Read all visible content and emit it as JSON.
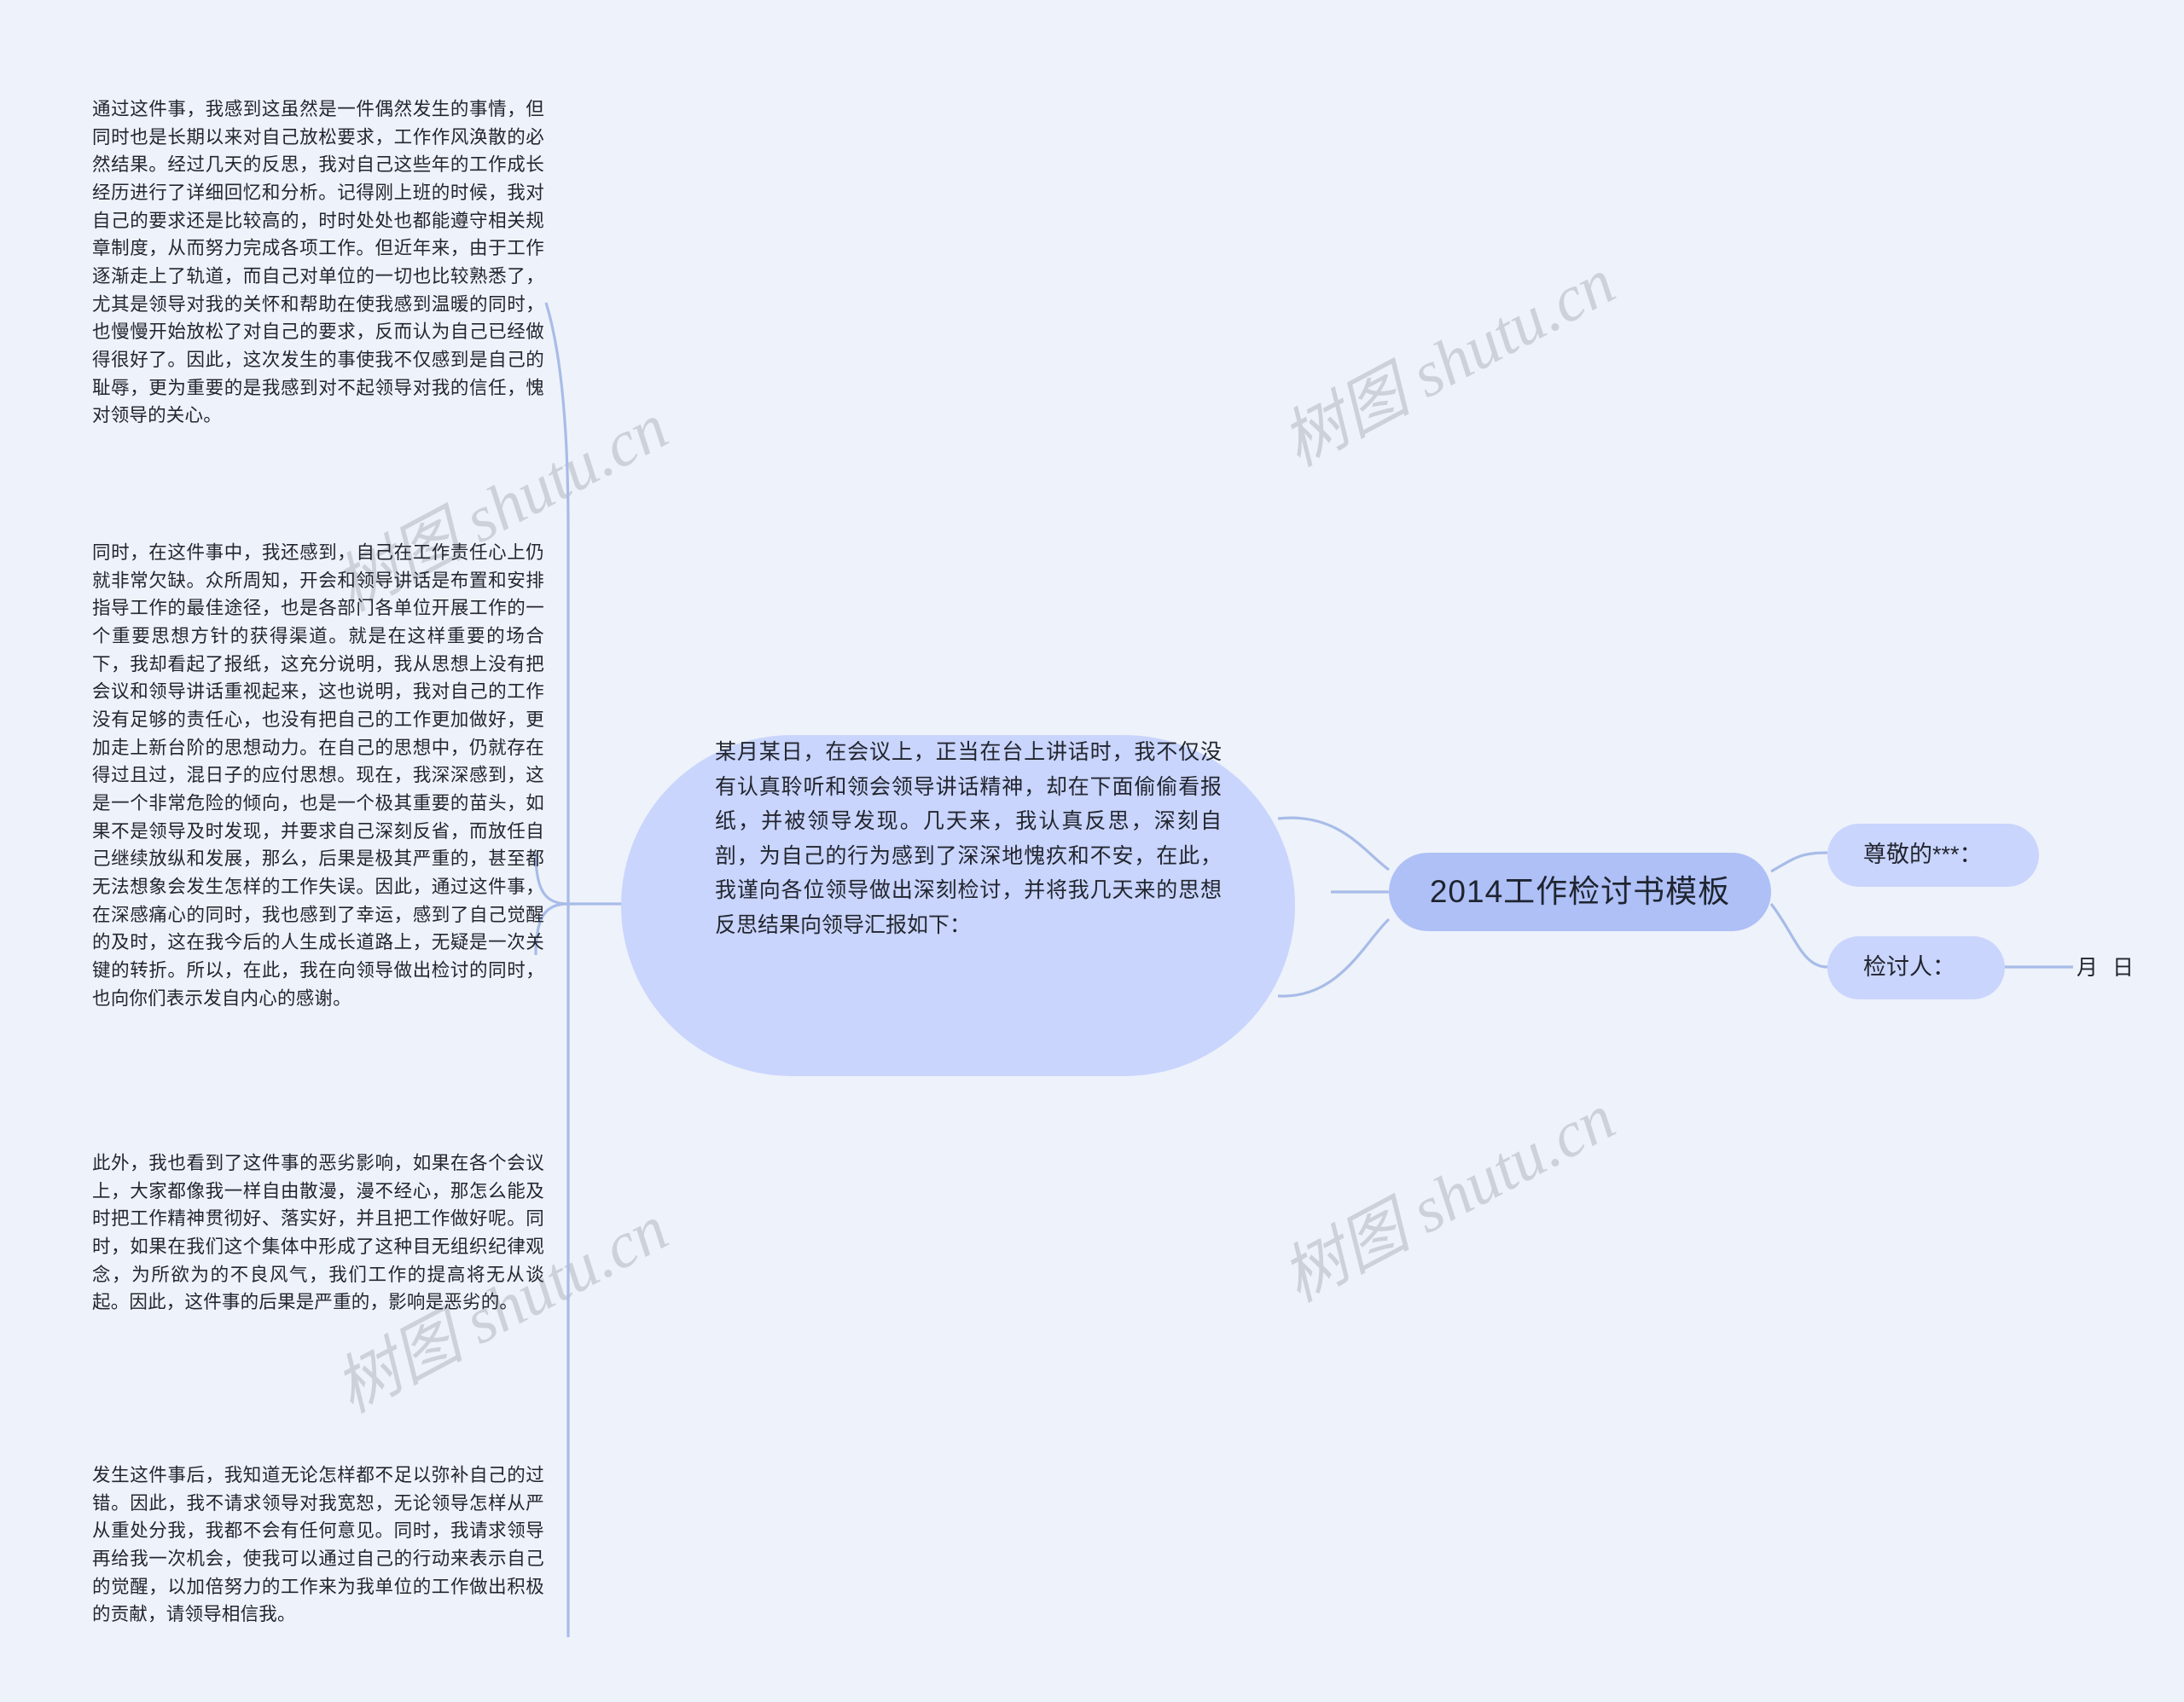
{
  "canvas": {
    "background_color": "#eef2fa",
    "node_fill": "#c9d5fd",
    "root_fill": "#aec0f6",
    "connector_color": "#a8bce8",
    "text_color": "#23262f"
  },
  "watermark": {
    "text": "树图 shutu.cn",
    "color": "#ccd1da",
    "instances": [
      "树图 shutu.cn",
      "树图 shutu.cn",
      "树图 shutu.cn",
      "树图 shutu.cn"
    ]
  },
  "root": {
    "title": "2014工作检讨书模板"
  },
  "center_branch": {
    "text": "某月某日，在会议上，正当在台上讲话时，我不仅没有认真聆听和领会领导讲话精神，却在下面偷偷看报纸，并被领导发现。几天来，我认真反思，深刻自剖，为自己的行为感到了深深地愧疚和不安，在此，我谨向各位领导做出深刻检讨，并将我几天来的思想反思结果向领导汇报如下："
  },
  "left_branches": [
    {
      "id": "para-1",
      "text": "通过这件事，我感到这虽然是一件偶然发生的事情，但同时也是长期以来对自己放松要求，工作作风涣散的必然结果。经过几天的反思，我对自己这些年的工作成长经历进行了详细回忆和分析。记得刚上班的时候，我对自己的要求还是比较高的，时时处处也都能遵守相关规章制度，从而努力完成各项工作。但近年来，由于工作逐渐走上了轨道，而自己对单位的一切也比较熟悉了，尤其是领导对我的关怀和帮助在使我感到温暖的同时，也慢慢开始放松了对自己的要求，反而认为自己已经做得很好了。因此，这次发生的事使我不仅感到是自己的耻辱，更为重要的是我感到对不起领导对我的信任，愧对领导的关心。"
    },
    {
      "id": "para-2",
      "text": "同时，在这件事中，我还感到，自己在工作责任心上仍就非常欠缺。众所周知，开会和领导讲话是布置和安排指导工作的最佳途径，也是各部门各单位开展工作的一个重要思想方针的获得渠道。就是在这样重要的场合下，我却看起了报纸，这充分说明，我从思想上没有把会议和领导讲话重视起来，这也说明，我对自己的工作没有足够的责任心，也没有把自己的工作更加做好，更加走上新台阶的思想动力。在自己的思想中，仍就存在得过且过，混日子的应付思想。现在，我深深感到，这是一个非常危险的倾向，也是一个极其重要的苗头，如果不是领导及时发现，并要求自己深刻反省，而放任自己继续放纵和发展，那么，后果是极其严重的，甚至都无法想象会发生怎样的工作失误。因此，通过这件事，在深感痛心的同时，我也感到了幸运，感到了自己觉醒的及时，这在我今后的人生成长道路上，无疑是一次关键的转折。所以，在此，我在向领导做出检讨的同时，也向你们表示发自内心的感谢。"
    },
    {
      "id": "para-3",
      "text": "此外，我也看到了这件事的恶劣影响，如果在各个会议上，大家都像我一样自由散漫，漫不经心，那怎么能及时把工作精神贯彻好、落实好，并且把工作做好呢。同时，如果在我们这个集体中形成了这种目无组织纪律观念，为所欲为的不良风气，我们工作的提高将无从谈起。因此，这件事的后果是严重的，影响是恶劣的。"
    },
    {
      "id": "para-4",
      "text": "发生这件事后，我知道无论怎样都不足以弥补自己的过错。因此，我不请求领导对我宽恕，无论领导怎样从严从重处分我，我都不会有任何意见。同时，我请求领导再给我一次机会，使我可以通过自己的行动来表示自己的觉醒，以加倍努力的工作来为我单位的工作做出积极的贡献，请领导相信我。"
    }
  ],
  "right_branches": [
    {
      "id": "rn-1",
      "label": "尊敬的***："
    },
    {
      "id": "rn-2",
      "label": "检讨人："
    }
  ],
  "right_leaf": {
    "label": "月 日"
  }
}
